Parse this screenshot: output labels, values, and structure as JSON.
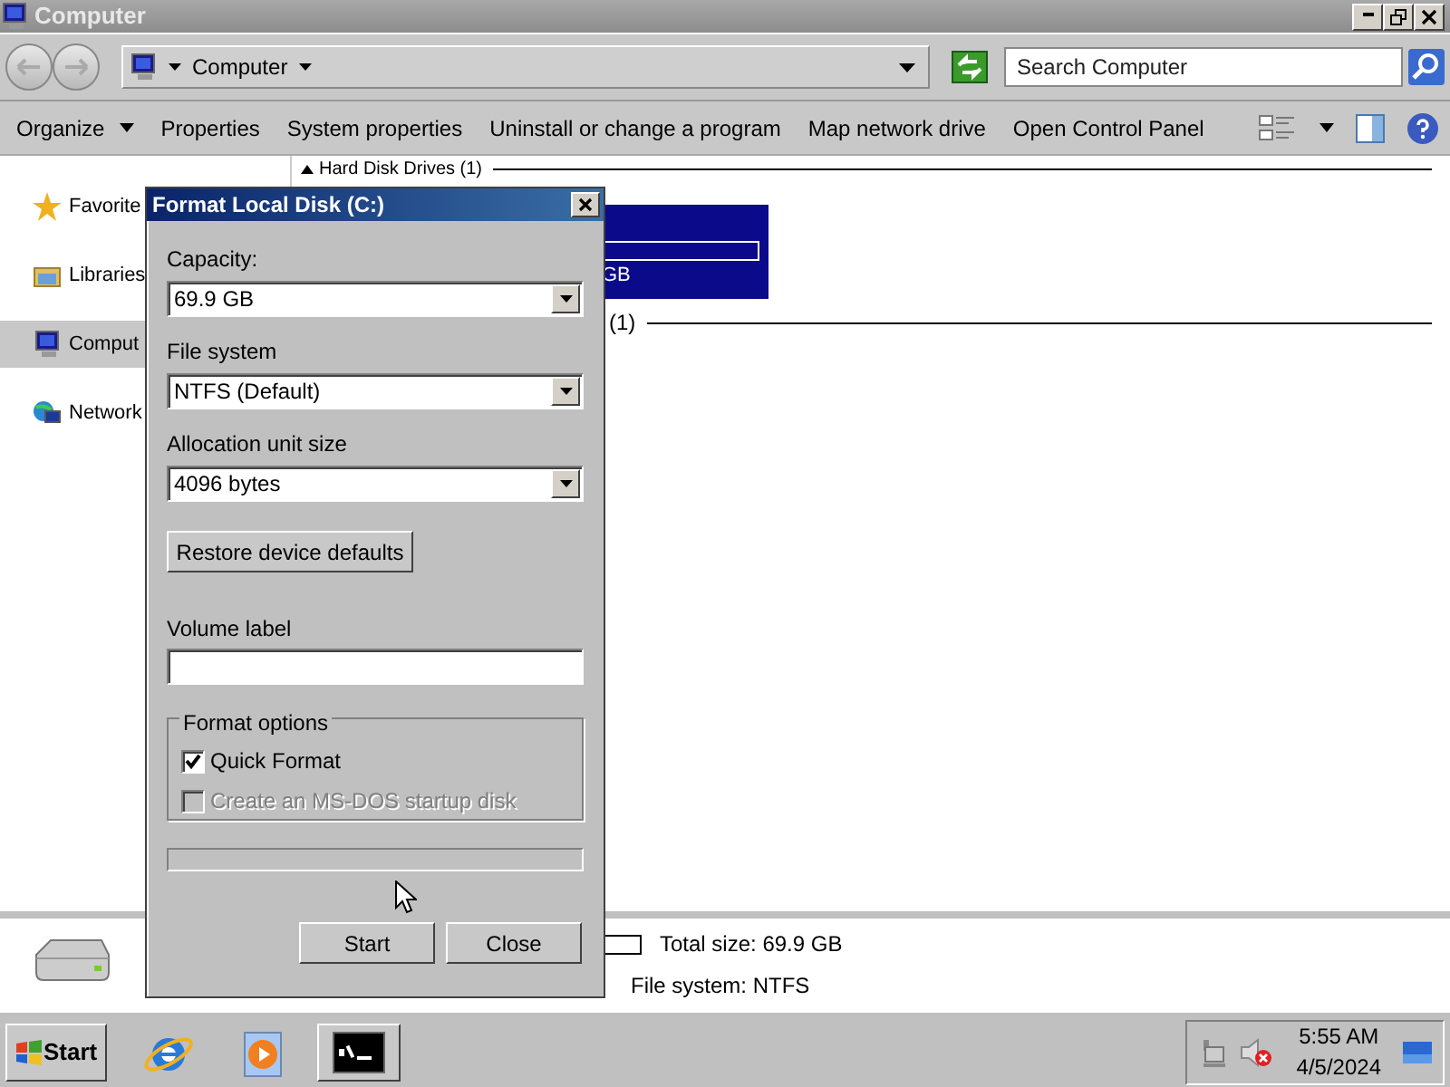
{
  "window": {
    "title": "Computer"
  },
  "address": {
    "location": "Computer"
  },
  "search": {
    "placeholder": "Search Computer"
  },
  "toolbar": [
    {
      "label": "Organize",
      "kind": "menu"
    },
    {
      "label": "Properties",
      "kind": "plain"
    },
    {
      "label": "System properties",
      "kind": "plain"
    },
    {
      "label": "Uninstall or change a program",
      "kind": "plain"
    },
    {
      "label": "Map network drive",
      "kind": "plain"
    },
    {
      "label": "Open Control Panel",
      "kind": "plain"
    }
  ],
  "nav": [
    {
      "label": "Favorite",
      "kind": "star",
      "selected": false
    },
    {
      "label": "Libraries",
      "kind": "library",
      "selected": false
    },
    {
      "label": "Comput",
      "kind": "computer",
      "selected": true
    },
    {
      "label": "Network",
      "kind": "network",
      "selected": false
    }
  ],
  "content": {
    "group_header": "Hard Disk Drives (1)",
    "drive_fragment": "GB",
    "second_header": "(1)"
  },
  "details": {
    "total_size": "Total size: 69.9 GB",
    "file_system": "File system: NTFS"
  },
  "dialog": {
    "title": "Format Local Disk (C:)",
    "fields": [
      {
        "label": "Capacity:",
        "value": "69.9 GB"
      },
      {
        "label": "File system",
        "value": "NTFS (Default)"
      },
      {
        "label": "Allocation unit size",
        "value": "4096 bytes"
      }
    ],
    "restore_button": "Restore device defaults",
    "volume_caption": "Volume label",
    "format_options": {
      "title": "Format options",
      "options": [
        {
          "label": "Quick Format",
          "checked": true,
          "disabled": false
        },
        {
          "label": "Create an MS-DOS startup disk",
          "checked": false,
          "disabled": true
        }
      ]
    },
    "progress": {
      "level": 0
    },
    "buttons": [
      "Start",
      "Close"
    ]
  },
  "taskbar": {
    "start": "Start",
    "apps": [
      {
        "kind": "browser",
        "selected": false
      },
      {
        "kind": "media",
        "selected": false
      },
      {
        "kind": "console",
        "selected": true
      }
    ],
    "time": "5:55 AM",
    "date": "4/5/2024"
  }
}
